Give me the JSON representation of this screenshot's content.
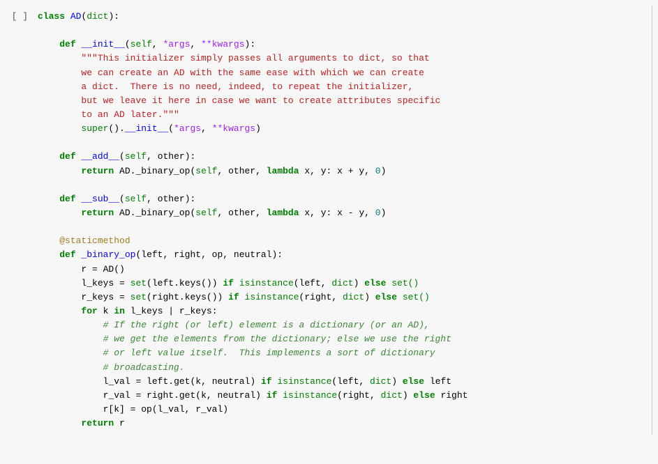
{
  "prompt": "[ ]",
  "code": {
    "l1": {
      "class_kw": "class",
      "clsname": "AD",
      "dict": "dict"
    },
    "init": {
      "def": "def",
      "name": "__init__",
      "self": "self",
      "args": "*args",
      "kwargs": "**kwargs"
    },
    "doc1": "\"\"\"This initializer simply passes all arguments to dict, so that",
    "doc2": "we can create an AD with the same ease with which we can create",
    "doc3": "a dict.  There is no need, indeed, to repeat the initializer,",
    "doc4": "but we leave it here in case we want to create attributes specific",
    "doc5": "to an AD later.\"\"\"",
    "supercall": {
      "super": "super",
      "init": "__init__",
      "args": "*args",
      "kwargs": "**kwargs"
    },
    "add": {
      "def": "def",
      "name": "__add__",
      "self": "self",
      "other": "other",
      "return": "return",
      "ad": "AD._binary_op",
      "lambda": "lambda",
      "expr": "x + y",
      "zero": "0"
    },
    "sub": {
      "def": "def",
      "name": "__sub__",
      "self": "self",
      "other": "other",
      "return": "return",
      "ad": "AD._binary_op",
      "lambda": "lambda",
      "expr": "x - y",
      "zero": "0"
    },
    "static": "@staticmethod",
    "binop": {
      "def": "def",
      "name": "_binary_op",
      "args": "left, right, op, neutral"
    },
    "r_assign": "r = AD()",
    "lkeys": {
      "var": "l_keys",
      "set": "set",
      "left": "left",
      "keys": "keys()",
      "if": "if",
      "isinstance": "isinstance",
      "dict": "dict",
      "else": "else",
      "empty": "set()"
    },
    "rkeys": {
      "var": "r_keys",
      "set": "set",
      "right": "right",
      "keys": "keys()",
      "if": "if",
      "isinstance": "isinstance",
      "dict": "dict",
      "else": "else",
      "empty": "set()"
    },
    "for": {
      "for": "for",
      "k": "k",
      "in": "in",
      "expr": "l_keys | r_keys"
    },
    "c1": "# If the right (or left) element is a dictionary (or an AD),",
    "c2": "# we get the elements from the dictionary; else we use the right",
    "c3": "# or left value itself.  This implements a sort of dictionary",
    "c4": "# broadcasting.",
    "lval": {
      "var": "l_val",
      "left": "left",
      "get": "get",
      "k": "k",
      "neutral": "neutral",
      "if": "if",
      "isinstance": "isinstance",
      "dict": "dict",
      "else": "else",
      "tail": "left"
    },
    "rval": {
      "var": "r_val",
      "right": "right",
      "get": "get",
      "k": "k",
      "neutral": "neutral",
      "if": "if",
      "isinstance": "isinstance",
      "dict": "dict",
      "else": "else",
      "tail": "right"
    },
    "rassign": "r[k] = op(l_val, r_val)",
    "retr": {
      "return": "return",
      "r": "r"
    }
  }
}
